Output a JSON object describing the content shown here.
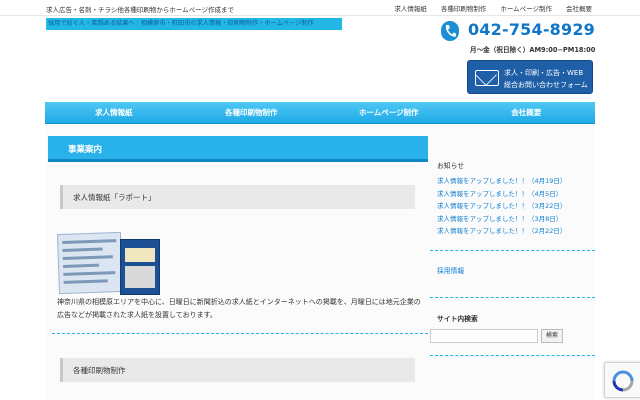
{
  "header": {
    "tagline": "求人広告・名刺・チラシ他各種印刷物からホームページ作成まで",
    "top_links": [
      "求人情報紙",
      "各種印刷物制作",
      "ホームページ制作",
      "会社概要"
    ],
    "logo_text": "採用で紡ぐ人・笑顔ある結果へ｜相模原市・町田市の求人情報・印刷物制作・ホームページ制作",
    "phone": "042-754-8929",
    "hours": "月～金（祝日除く）AM9:00−PM18:00",
    "contact_line1": "求人・印刷・広告・WEB",
    "contact_line2": "総合お問い合わせフォーム"
  },
  "nav": {
    "items": [
      "求人情報紙",
      "各種印刷物制作",
      "ホームページ制作",
      "会社概要"
    ]
  },
  "main": {
    "section_title": "事業案内",
    "subsection1": "求人情報紙「ラポート」",
    "description": "神奈川県の相模原エリアを中心に、日曜日に新聞折込の求人紙とインターネットへの掲載を、月曜日には地元企業の広告などが掲載された求人紙を設置しております。",
    "subsection2": "各種印刷物制作"
  },
  "sidebar": {
    "news_title": "お知らせ",
    "news": [
      {
        "title": "求人情報をアップしました！！",
        "date": "（4月19日）"
      },
      {
        "title": "求人情報をアップしました！！",
        "date": "（4月5日）"
      },
      {
        "title": "求人情報をアップしました！！",
        "date": "（3月22日）"
      },
      {
        "title": "求人情報をアップしました！！",
        "date": "（3月8日）"
      },
      {
        "title": "求人情報をアップしました！！",
        "date": "（2月22日）"
      }
    ],
    "recruit_link": "採用情報",
    "search_title": "サイト内検索",
    "search_button": "検索"
  },
  "colors": {
    "accent": "#29b1ea",
    "nav": "#1ea9e6",
    "link": "#0d7fd1",
    "contact_button": "#1e5fa8"
  }
}
